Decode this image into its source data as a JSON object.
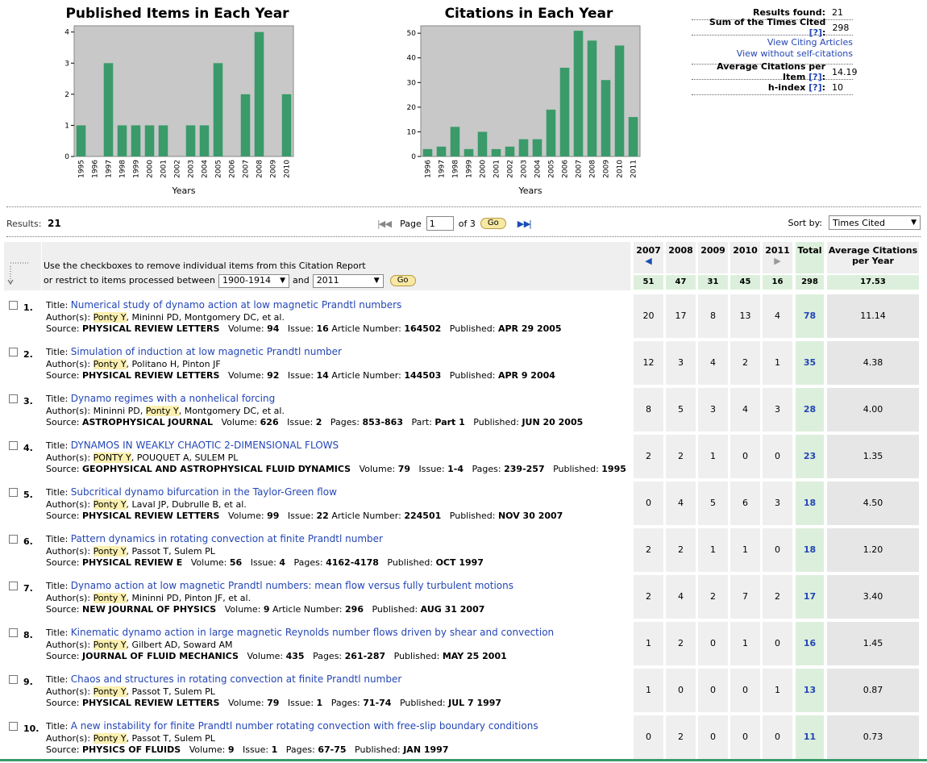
{
  "chart_data": [
    {
      "type": "bar",
      "title": "Published Items in Each Year",
      "xlabel": "Years",
      "ylabel": "",
      "ylim": [
        0,
        4.2
      ],
      "yticks": [
        0,
        1,
        2,
        3,
        4
      ],
      "categories": [
        "1995",
        "1996",
        "1997",
        "1998",
        "1999",
        "2000",
        "2001",
        "2002",
        "2003",
        "2004",
        "2005",
        "2006",
        "2007",
        "2008",
        "2009",
        "2010"
      ],
      "values": [
        1,
        0,
        3,
        1,
        1,
        1,
        1,
        0,
        1,
        1,
        3,
        0,
        2,
        4,
        0,
        2
      ],
      "color": "#3a9a6a"
    },
    {
      "type": "bar",
      "title": "Citations in Each Year",
      "xlabel": "Years",
      "ylabel": "",
      "ylim": [
        0,
        53
      ],
      "yticks": [
        0,
        10,
        20,
        30,
        40,
        50
      ],
      "categories": [
        "1996",
        "1997",
        "1998",
        "1999",
        "2000",
        "2001",
        "2002",
        "2003",
        "2004",
        "2005",
        "2006",
        "2007",
        "2008",
        "2009",
        "2010",
        "2011"
      ],
      "values": [
        3,
        4,
        12,
        3,
        10,
        3,
        4,
        7,
        7,
        19,
        36,
        51,
        47,
        31,
        45,
        16
      ],
      "color": "#3a9a6a"
    }
  ],
  "stats": {
    "results_found_label": "Results found:",
    "results_found": "21",
    "sum_label": "Sum of the Times Cited",
    "help": "[?]",
    "colon": ":",
    "sum": "298",
    "view_citing": "View Citing Articles",
    "view_without": "View without self-citations",
    "avg_label": "Average Citations per Item",
    "avg": "14.19",
    "hindex_label": "h-index",
    "hindex": "10"
  },
  "toolbar": {
    "results_label": "Results:",
    "results_count": "21",
    "page_label": "Page",
    "page_value": "1",
    "of_label": "of 3",
    "go": "Go",
    "sort_label": "Sort by:",
    "sort_value": "Times Cited"
  },
  "header": {
    "line1": "Use the checkboxes to remove individual items from this Citation Report",
    "line2_prefix": "or restrict to items processed between",
    "from_year": "1900-1914",
    "and": "and",
    "to_year": "2011",
    "go": "Go",
    "years": [
      "2007",
      "2008",
      "2009",
      "2010",
      "2011"
    ],
    "total_label": "Total",
    "avg_label": "Average Citations per Year",
    "year_sums": [
      "51",
      "47",
      "31",
      "45",
      "16"
    ],
    "total_sum": "298",
    "avg_sum": "17.53"
  },
  "labels": {
    "title": "Title:",
    "authors": "Author(s):",
    "source": "Source:"
  },
  "rows": [
    {
      "num": "1.",
      "title": "Numerical study of dynamo action at low magnetic Prandtl numbers",
      "author_hl": "Ponty Y",
      "authors_rest": ", Mininni PD, Montgomery DC, et al.",
      "source": "PHYSICAL REVIEW LETTERS",
      "details": [
        [
          "Volume:",
          "94"
        ],
        [
          "Issue:",
          "16"
        ],
        [
          "Article Number:",
          "164502"
        ],
        [
          "Published:",
          "APR 29 2005"
        ]
      ],
      "cites": [
        "20",
        "17",
        "8",
        "13",
        "4"
      ],
      "total": "78",
      "avg": "11.14"
    },
    {
      "num": "2.",
      "title": "Simulation of induction at low magnetic Prandtl number",
      "author_hl": "Ponty Y",
      "authors_rest": ", Politano H, Pinton JF",
      "source": "PHYSICAL REVIEW LETTERS",
      "details": [
        [
          "Volume:",
          "92"
        ],
        [
          "Issue:",
          "14"
        ],
        [
          "Article Number:",
          "144503"
        ],
        [
          "Published:",
          "APR 9 2004"
        ]
      ],
      "cites": [
        "12",
        "3",
        "4",
        "2",
        "1"
      ],
      "total": "35",
      "avg": "4.38"
    },
    {
      "num": "3.",
      "title": "Dynamo regimes with a nonhelical forcing",
      "author_pre": "Mininni PD, ",
      "author_hl": "Ponty Y",
      "authors_rest": ", Montgomery DC, et al.",
      "source": "ASTROPHYSICAL JOURNAL",
      "details": [
        [
          "Volume:",
          "626"
        ],
        [
          "Issue:",
          "2"
        ],
        [
          "Pages:",
          "853-863"
        ],
        [
          "Part:",
          "Part 1"
        ],
        [
          "Published:",
          "JUN 20 2005"
        ]
      ],
      "cites": [
        "8",
        "5",
        "3",
        "4",
        "3"
      ],
      "total": "28",
      "avg": "4.00"
    },
    {
      "num": "4.",
      "title": "DYNAMOS IN WEAKLY CHAOTIC 2-DIMENSIONAL FLOWS",
      "author_hl": "PONTY Y",
      "authors_rest": ", POUQUET A, SULEM PL",
      "source": "GEOPHYSICAL AND ASTROPHYSICAL FLUID DYNAMICS",
      "details": [
        [
          "Volume:",
          "79"
        ],
        [
          "Issue:",
          "1-4"
        ],
        [
          "Pages:",
          "239-257"
        ],
        [
          "Published:",
          "1995"
        ]
      ],
      "cites": [
        "2",
        "2",
        "1",
        "0",
        "0"
      ],
      "total": "23",
      "avg": "1.35"
    },
    {
      "num": "5.",
      "title": "Subcritical dynamo bifurcation in the Taylor-Green flow",
      "author_hl": "Ponty Y",
      "authors_rest": ", Laval JP, Dubrulle B, et al.",
      "source": "PHYSICAL REVIEW LETTERS",
      "details": [
        [
          "Volume:",
          "99"
        ],
        [
          "Issue:",
          "22"
        ],
        [
          "Article Number:",
          "224501"
        ],
        [
          "Published:",
          "NOV 30 2007"
        ]
      ],
      "cites": [
        "0",
        "4",
        "5",
        "6",
        "3"
      ],
      "total": "18",
      "avg": "4.50"
    },
    {
      "num": "6.",
      "title": "Pattern dynamics in rotating convection at finite Prandtl number",
      "author_hl": "Ponty Y",
      "authors_rest": ", Passot T, Sulem PL",
      "source": "PHYSICAL REVIEW E",
      "details": [
        [
          "Volume:",
          "56"
        ],
        [
          "Issue:",
          "4"
        ],
        [
          "Pages:",
          "4162-4178"
        ],
        [
          "Published:",
          "OCT 1997"
        ]
      ],
      "cites": [
        "2",
        "2",
        "1",
        "1",
        "0"
      ],
      "total": "18",
      "avg": "1.20"
    },
    {
      "num": "7.",
      "title": "Dynamo action at low magnetic Prandtl numbers: mean flow versus fully turbulent motions",
      "author_hl": "Ponty Y",
      "authors_rest": ", Mininni PD, Pinton JF, et al.",
      "source": "NEW JOURNAL OF PHYSICS",
      "details": [
        [
          "Volume:",
          "9"
        ],
        [
          "Article Number:",
          "296"
        ],
        [
          "Published:",
          "AUG 31 2007"
        ]
      ],
      "cites": [
        "2",
        "4",
        "2",
        "7",
        "2"
      ],
      "total": "17",
      "avg": "3.40"
    },
    {
      "num": "8.",
      "title": "Kinematic dynamo action in large magnetic Reynolds number flows driven by shear and convection",
      "author_hl": "Ponty Y",
      "authors_rest": ", Gilbert AD, Soward AM",
      "source": "JOURNAL OF FLUID MECHANICS",
      "details": [
        [
          "Volume:",
          "435"
        ],
        [
          "Pages:",
          "261-287"
        ],
        [
          "Published:",
          "MAY 25 2001"
        ]
      ],
      "cites": [
        "1",
        "2",
        "0",
        "1",
        "0"
      ],
      "total": "16",
      "avg": "1.45"
    },
    {
      "num": "9.",
      "title": "Chaos and structures in rotating convection at finite Prandtl number",
      "author_hl": "Ponty Y",
      "authors_rest": ", Passot T, Sulem PL",
      "source": "PHYSICAL REVIEW LETTERS",
      "details": [
        [
          "Volume:",
          "79"
        ],
        [
          "Issue:",
          "1"
        ],
        [
          "Pages:",
          "71-74"
        ],
        [
          "Published:",
          "JUL 7 1997"
        ]
      ],
      "cites": [
        "1",
        "0",
        "0",
        "0",
        "1"
      ],
      "total": "13",
      "avg": "0.87"
    },
    {
      "num": "10.",
      "title": "A new instability for finite Prandtl number rotating convection with free-slip boundary conditions",
      "author_hl": "Ponty Y",
      "authors_rest": ", Passot T, Sulem PL",
      "source": "PHYSICS OF FLUIDS",
      "details": [
        [
          "Volume:",
          "9"
        ],
        [
          "Issue:",
          "1"
        ],
        [
          "Pages:",
          "67-75"
        ],
        [
          "Published:",
          "JAN 1997"
        ]
      ],
      "cites": [
        "0",
        "2",
        "0",
        "0",
        "0"
      ],
      "total": "11",
      "avg": "0.73"
    }
  ]
}
